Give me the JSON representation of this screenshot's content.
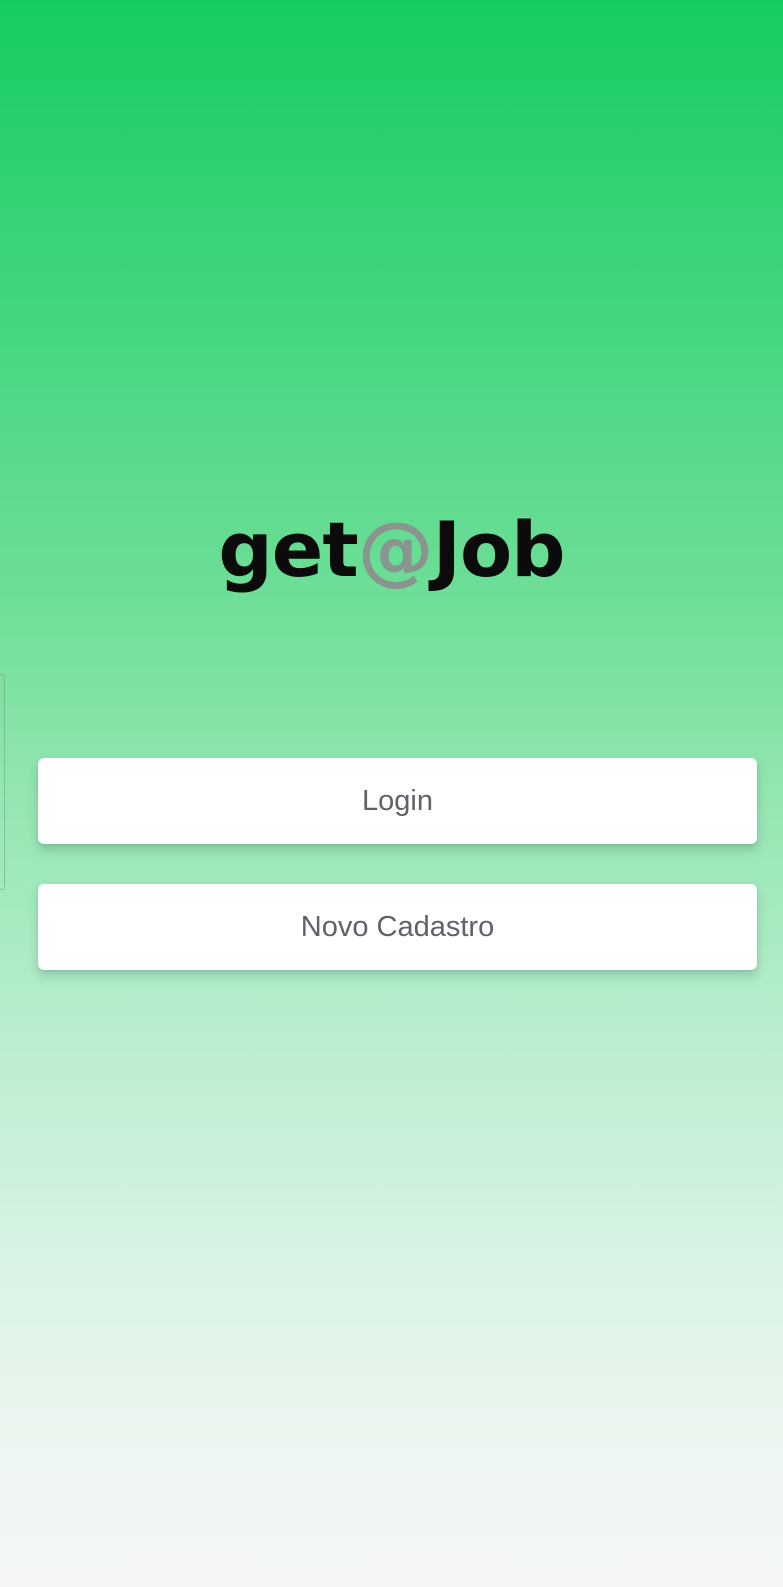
{
  "app": {
    "logo": {
      "prefix": "get",
      "at": "@",
      "suffix": "Job"
    }
  },
  "actions": {
    "login_label": "Login",
    "register_label": "Novo Cadastro"
  },
  "colors": {
    "gradient_top": "#16cc5f",
    "gradient_bottom": "#f4f6f5",
    "logo_text": "#0b0b0b",
    "logo_at": "#8a9590",
    "button_bg": "#ffffff",
    "button_text": "#5f6368"
  }
}
